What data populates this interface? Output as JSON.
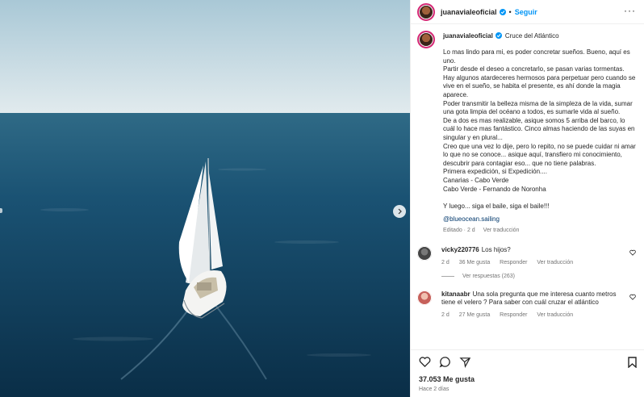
{
  "post": {
    "username": "juanavialeoficial",
    "follow_label": "Seguir",
    "separator": "•",
    "more_label": "···",
    "location": "Cruce del Atlántico",
    "caption": "Lo mas lindo para mi, es poder concretar sueños. Bueno, aquí es uno.\nPartir desde el deseo a concretarlo, se pasan varias tormentas.\nHay algunos atardeceres hermosos para perpetuar pero cuando se vive en el sueño, se habita el presente, es ahí donde la magia aparece.\nPoder transmitir la belleza misma de la simpleza de la vida, sumar una gota limpia del océano a todos, es sumarle vida al sueño.\nDe a dos es mas realizable, asique somos 5 arriba del barco, lo cuál lo hace mas fantástico. Cinco almas haciendo de las suyas en singular y en plural...\nCreo que una vez lo dije, pero lo repito, no se puede cuidar ni amar lo que no se conoce... asique aquí, transfiero mi conocimiento, descubrir para contagiar eso... que no tiene palabras.\nPrimera expedición, si Expedición....\nCanarias - Cabo Verde\nCabo Verde - Fernando de Noronha\n\nY luego... siga el baile, siga el baile!!!",
    "mention": "@blueocean.sailing",
    "edited": "Editado · 2 d",
    "translate": "Ver traducción"
  },
  "comments": [
    {
      "username": "vicky220776",
      "text": "Los hijos?",
      "time": "2 d",
      "likes": "36 Me gusta",
      "reply": "Responder",
      "translate": "Ver traducción",
      "replies": "Ver respuestas (263)"
    },
    {
      "username": "kitanaabr",
      "text": "Una sola pregunta que me interesa cuanto metros tiene el velero ? Para saber con cuál cruzar el atlántico",
      "time": "2 d",
      "likes": "27 Me gusta",
      "reply": "Responder",
      "translate": "Ver traducción"
    }
  ],
  "footer": {
    "likes": "37.053 Me gusta",
    "date": "Hace 2 días"
  },
  "colors": {
    "accent": "#0095f6",
    "sea": "#0d3a55",
    "sky": "#c9dde6"
  }
}
